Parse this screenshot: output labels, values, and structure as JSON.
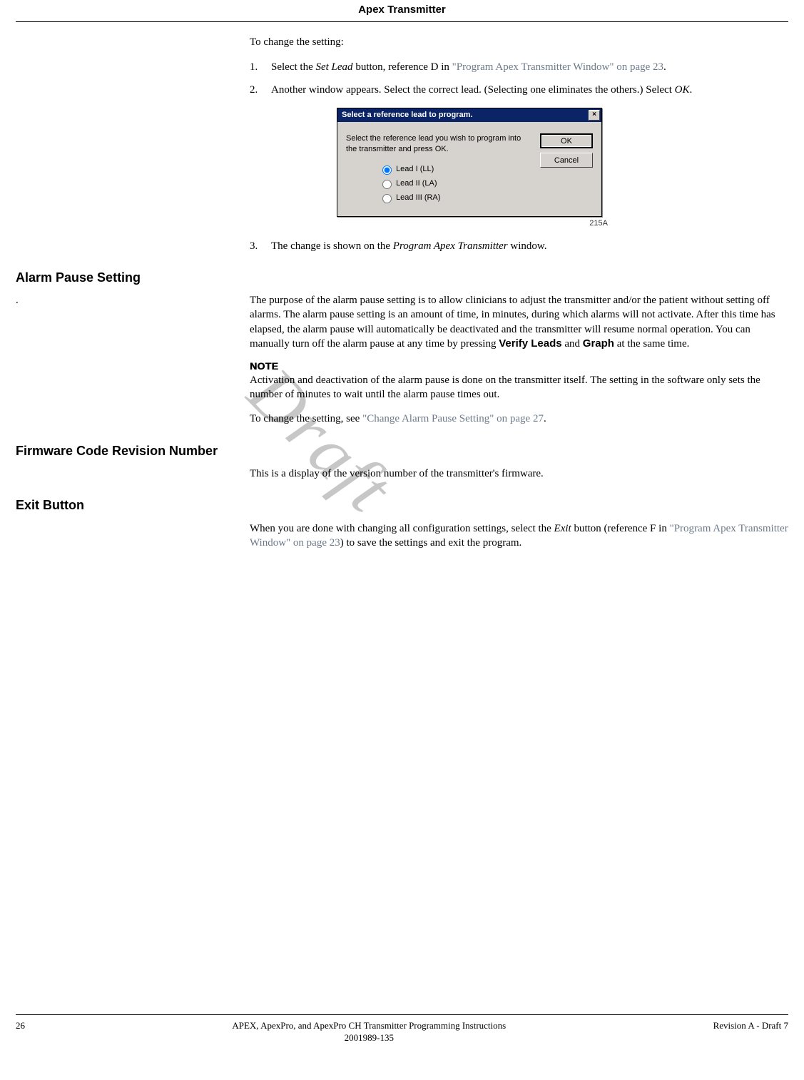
{
  "header": {
    "title": "Apex Transmitter"
  },
  "intro": {
    "lead": "To change the setting:"
  },
  "steps": {
    "s1_pre": "Select the ",
    "s1_setlead": "Set Lead",
    "s1_mid": " button, reference D in ",
    "s1_xref": "\"Program Apex Transmitter Window\" on page 23",
    "s1_post": ".",
    "s2_pre": "Another window appears. Select the correct lead. (Selecting one eliminates the others.) Select ",
    "s2_ok": "OK",
    "s2_post": ".",
    "s3_pre": "The change is shown on the ",
    "s3_win": "Program Apex Transmitter",
    "s3_post": " window."
  },
  "dialog": {
    "title": "Select a reference lead to program.",
    "prompt": "Select the reference lead you wish to program into the transmitter and press OK.",
    "radios": {
      "r1": "Lead I  (LL)",
      "r2": "Lead II  (LA)",
      "r3": "Lead III  (RA)"
    },
    "ok": "OK",
    "cancel": "Cancel",
    "caption": "215A"
  },
  "alarm": {
    "heading": "Alarm Pause Setting",
    "dot": ".",
    "para_pre": "The purpose of the alarm pause setting is to allow clinicians to adjust the transmitter and/or the patient without setting off alarms. The alarm pause setting is an amount of time, in minutes, during which alarms will not activate. After this time has elapsed, the alarm pause will automatically be deactivated and the transmitter will resume normal operation. You can manually turn off the alarm pause at any time by pressing ",
    "verify": "Verify Leads",
    "and": " and ",
    "graph": "Graph",
    "para_post": " at the same time.",
    "note_label": "NOTE",
    "note_body": "Activation and deactivation of the alarm pause is done on the transmitter itself. The setting in the software only sets the number of minutes to wait until the alarm pause times out.",
    "change_pre": "To change the setting, see ",
    "change_xref": "\"Change Alarm Pause Setting\" on page 27",
    "change_post": "."
  },
  "firmware": {
    "heading": "Firmware Code Revision Number",
    "body": "This is a display of the version number of the transmitter's firmware."
  },
  "exit": {
    "heading": "Exit Button",
    "pre": "When you are done with changing all configuration settings, select the ",
    "exit": "Exit",
    "mid": " button (reference F in ",
    "xref": "\"Program Apex Transmitter Window\" on page 23",
    "post": ") to save the settings and exit the program."
  },
  "footer": {
    "pagenum": "26",
    "center1": "APEX, ApexPro, and ApexPro CH Transmitter Programming Instructions",
    "center2": "2001989-135",
    "right": "Revision A - Draft 7"
  },
  "watermark": "Draft"
}
